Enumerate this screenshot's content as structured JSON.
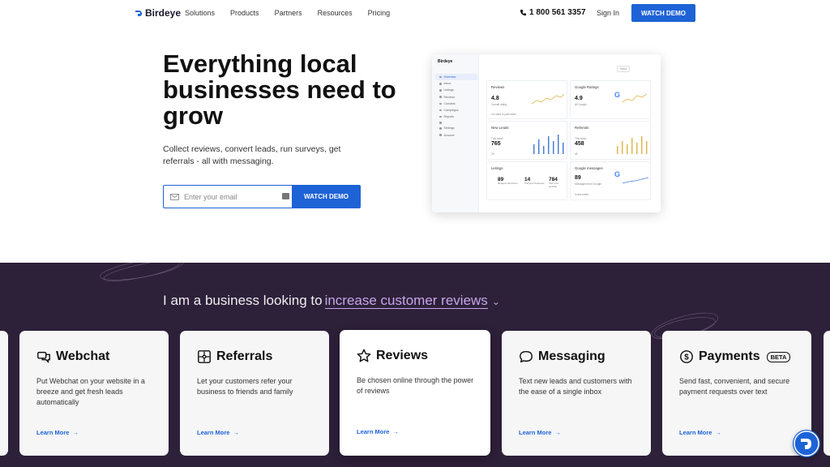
{
  "nav": {
    "brand": "Birdeye",
    "links": [
      "Solutions",
      "Products",
      "Partners",
      "Resources",
      "Pricing"
    ],
    "phone": "1 800 561 3357",
    "signin": "Sign In",
    "cta": "WATCH DEMO"
  },
  "hero": {
    "title": "Everything local businesses need to grow",
    "subtitle": "Collect reviews, convert leads, run surveys, get referrals - all with messaging.",
    "email_placeholder": "Enter your email",
    "cta": "WATCH DEMO"
  },
  "dashboard": {
    "brand": "Birdeye",
    "menu": [
      "Overview",
      "Inbox",
      "Listings",
      "Reviews",
      "Contacts",
      "Campaigns",
      "Reports",
      "Settings",
      "Account"
    ],
    "top_button": "Send",
    "cards": {
      "reviews": {
        "title": "Reviews",
        "value": "4.8",
        "sub": "Overall rating",
        "foot": "0.5 stars in past week"
      },
      "google_ratings": {
        "title": "Google Ratings",
        "value": "4.9",
        "sub": "All Google"
      },
      "new_leads": {
        "title": "New Leads",
        "sub": "This week",
        "value": "765",
        "foot": "25"
      },
      "referrals": {
        "title": "Referrals",
        "sub": "This week",
        "value": "458",
        "foot": "45"
      },
      "listings": {
        "title": "Listings",
        "items": [
          {
            "value": "89",
            "label": "Request directions"
          },
          {
            "value": "14",
            "label": "Call your business"
          },
          {
            "value": "784",
            "label": "Visit your website"
          }
        ]
      },
      "google_messages": {
        "title": "Google messages",
        "value": "89",
        "sub": "Messages from Google",
        "foot": "In this week"
      }
    },
    "day_labels": "S M T W T F S"
  },
  "section": {
    "prefix": "I am a business looking to",
    "highlight": "increase customer reviews"
  },
  "products": [
    {
      "name": "Webchat",
      "icon": "webchat-icon",
      "desc": "Put Webchat on your website in a breeze and get fresh leads automatically",
      "link": "Learn More"
    },
    {
      "name": "Referrals",
      "icon": "referrals-icon",
      "desc": "Let your customers refer your business to friends and family",
      "link": "Learn More"
    },
    {
      "name": "Reviews",
      "icon": "star-icon",
      "desc": "Be chosen online through the power of reviews",
      "link": "Learn More"
    },
    {
      "name": "Messaging",
      "icon": "message-bubble-icon",
      "desc": "Text new leads and customers with the ease of a single inbox",
      "link": "Learn More"
    },
    {
      "name": "Payments",
      "icon": "dollar-icon",
      "badge": "BETA",
      "desc": "Send fast, convenient, and secure payment requests over text",
      "link": "Learn More"
    }
  ],
  "colors": {
    "accent": "#1e63d6",
    "dark_bg": "#2d2039",
    "highlight": "#c6a6e8"
  }
}
